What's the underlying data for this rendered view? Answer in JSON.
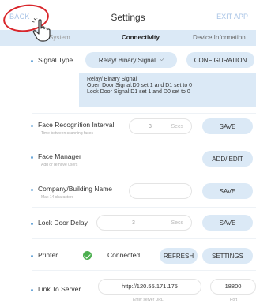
{
  "header": {
    "back_label": "BACK",
    "title": "Settings",
    "exit_label": "EXIT APP"
  },
  "tabs": [
    {
      "label": "System"
    },
    {
      "label": "Connectivity"
    },
    {
      "label": "Device Information"
    }
  ],
  "signal_type": {
    "label": "Signal Type",
    "value": "Relay/ Binary Signal",
    "config_label": "CONFIGURATION",
    "info_line1": "Relay/ Binary Signal",
    "info_line2": "Open Door Signal:D0 set 1 and D1 set to 0",
    "info_line3": "Lock Door Signal:D1 set 1 and D0 set to 0"
  },
  "face_recognition": {
    "label": "Face Recognition Interval",
    "sublabel": "Time between scanning faces",
    "value": "3",
    "unit": "Secs",
    "save_label": "SAVE"
  },
  "face_manager": {
    "label": "Face Manager",
    "sublabel": "Add or remove users",
    "button_label": "ADD/ EDIT"
  },
  "company_name": {
    "label": "Company/Building Name",
    "sublabel": "Max 14 characters",
    "value": "",
    "save_label": "SAVE"
  },
  "lock_delay": {
    "label": "Lock Door Delay",
    "value": "3",
    "unit": "Secs",
    "save_label": "SAVE"
  },
  "printer": {
    "label": "Printer",
    "status": "Connected",
    "refresh_label": "REFRESH",
    "settings_label": "SETTINGS",
    "status_color": "#4caf50"
  },
  "server": {
    "label": "Link To Server",
    "url": "http://120.55.171.175",
    "port": "18800",
    "url_hint": "Enter server URL",
    "port_hint": "Port"
  },
  "colors": {
    "accent_light": "#dbe9f6",
    "highlight_circle": "#d9262b"
  }
}
